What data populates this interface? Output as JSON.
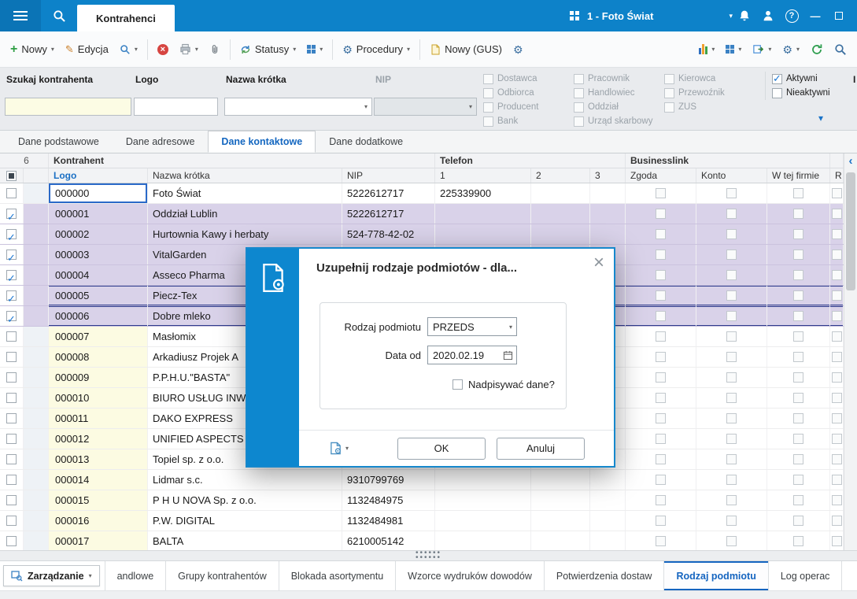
{
  "colors": {
    "accent": "#0d82c9",
    "checked_row": "#d9d2e9",
    "logo_cell": "#fcfbe2",
    "active_tab_text": "#1565c0"
  },
  "topbar": {
    "tab": "Kontrahenci",
    "company": "1 - Foto Świat"
  },
  "toolbar": {
    "nowy": "Nowy",
    "edycja": "Edycja",
    "statusy": "Statusy",
    "procedury": "Procedury",
    "nowy_gus": "Nowy (GUS)"
  },
  "filters": {
    "szukaj_label": "Szukaj kontrahenta",
    "logo_label": "Logo",
    "nazwa_label": "Nazwa krótka",
    "nip_label": "NIP",
    "search_value": "",
    "logo_value": "",
    "nazwa_value": "",
    "nip_value": "",
    "checkbox_columns": [
      [
        "Dostawca",
        "Odbiorca",
        "Producent",
        "Bank"
      ],
      [
        "Pracownik",
        "Handlowiec",
        "Oddział",
        "Urząd skarbowy"
      ],
      [
        "Kierowca",
        "Przewoźnik",
        "ZUS"
      ]
    ],
    "state_filters": [
      {
        "label": "Aktywni",
        "checked": true
      },
      {
        "label": "Nieaktywni",
        "checked": false
      }
    ],
    "cut_label": "I"
  },
  "data_tabs": [
    {
      "label": "Dane podstawowe",
      "active": false
    },
    {
      "label": "Dane adresowe",
      "active": false
    },
    {
      "label": "Dane kontaktowe",
      "active": true
    },
    {
      "label": "Dane dodatkowe",
      "active": false
    }
  ],
  "grid": {
    "selected_count": "6",
    "group_headers": {
      "kontrahent": "Kontrahent",
      "telefon": "Telefon",
      "businesslink": "Businesslink"
    },
    "columns": {
      "logo": "Logo",
      "nazwa": "Nazwa krótka",
      "nip": "NIP",
      "t1": "1",
      "t2": "2",
      "t3": "3",
      "zgoda": "Zgoda",
      "konto": "Konto",
      "wtf": "W tej firmie",
      "r": "R"
    },
    "rows": [
      {
        "logo": "000000",
        "nazwa": "Foto Świat",
        "nip": "5222612717",
        "tel1": "225339900",
        "checked": false,
        "selected": true,
        "framed": false
      },
      {
        "logo": "000001",
        "nazwa": "Oddział Lublin",
        "nip": "5222612717",
        "tel1": "",
        "checked": true,
        "selected": false,
        "framed": false
      },
      {
        "logo": "000002",
        "nazwa": "Hurtownia Kawy i herbaty",
        "nip": "524-778-42-02",
        "tel1": "",
        "checked": true,
        "selected": false,
        "framed": false
      },
      {
        "logo": "000003",
        "nazwa": "VitalGarden",
        "nip": "",
        "tel1": "",
        "checked": true,
        "selected": false,
        "framed": false
      },
      {
        "logo": "000004",
        "nazwa": "Asseco Pharma",
        "nip": "",
        "tel1": "",
        "checked": true,
        "selected": false,
        "framed": false
      },
      {
        "logo": "000005",
        "nazwa": "Piecz-Tex",
        "nip": "",
        "tel1": "",
        "checked": true,
        "selected": false,
        "framed": true
      },
      {
        "logo": "000006",
        "nazwa": "Dobre mleko",
        "nip": "",
        "tel1": "",
        "checked": true,
        "selected": false,
        "framed": true
      },
      {
        "logo": "000007",
        "nazwa": "Masłomix",
        "nip": "",
        "tel1": "",
        "checked": false,
        "selected": false,
        "framed": false
      },
      {
        "logo": "000008",
        "nazwa": "Arkadiusz Projek A",
        "nip": "",
        "tel1": "",
        "checked": false,
        "selected": false,
        "framed": false
      },
      {
        "logo": "000009",
        "nazwa": "P.P.H.U.\"BASTA\"",
        "nip": "",
        "tel1": "",
        "checked": false,
        "selected": false,
        "framed": false
      },
      {
        "logo": "000010",
        "nazwa": "BIURO USŁUG INW",
        "nip": "",
        "tel1": "",
        "checked": false,
        "selected": false,
        "framed": false
      },
      {
        "logo": "000011",
        "nazwa": "DAKO EXPRESS",
        "nip": "",
        "tel1": "",
        "checked": false,
        "selected": false,
        "framed": false
      },
      {
        "logo": "000012",
        "nazwa": "UNIFIED ASPECTS",
        "nip": "",
        "tel1": "",
        "checked": false,
        "selected": false,
        "framed": false
      },
      {
        "logo": "000013",
        "nazwa": "Topiel sp. z o.o.",
        "nip": "",
        "tel1": "",
        "checked": false,
        "selected": false,
        "framed": false
      },
      {
        "logo": "000014",
        "nazwa": "Lidmar s.c.",
        "nip": "9310799769",
        "tel1": "",
        "checked": false,
        "selected": false,
        "framed": false
      },
      {
        "logo": "000015",
        "nazwa": "P H U NOVA Sp. z o.o.",
        "nip": "1132484975",
        "tel1": "",
        "checked": false,
        "selected": false,
        "framed": false
      },
      {
        "logo": "000016",
        "nazwa": "P.W. DIGITAL",
        "nip": "1132484981",
        "tel1": "",
        "checked": false,
        "selected": false,
        "framed": false
      },
      {
        "logo": "000017",
        "nazwa": "BALTA",
        "nip": "6210005142",
        "tel1": "",
        "checked": false,
        "selected": false,
        "framed": false
      }
    ]
  },
  "dialog": {
    "title": "Uzupełnij rodzaje podmiotów - dla...",
    "rodzaj_label": "Rodzaj podmiotu",
    "rodzaj_value": "PRZEDS",
    "data_od_label": "Data od",
    "data_od_value": "2020.02.19",
    "nadpisywac_label": "Nadpisywać dane?",
    "ok_label": "OK",
    "anuluj_label": "Anuluj"
  },
  "bottom": {
    "manager_label": "Zarządzanie",
    "tabs": [
      {
        "label": "andlowe",
        "active": false
      },
      {
        "label": "Grupy kontrahentów",
        "active": false
      },
      {
        "label": "Blokada asortymentu",
        "active": false
      },
      {
        "label": "Wzorce wydruków dowodów",
        "active": false
      },
      {
        "label": "Potwierdzenia dostaw",
        "active": false
      },
      {
        "label": "Rodzaj podmiotu",
        "active": true
      },
      {
        "label": "Log operac",
        "active": false
      }
    ]
  }
}
